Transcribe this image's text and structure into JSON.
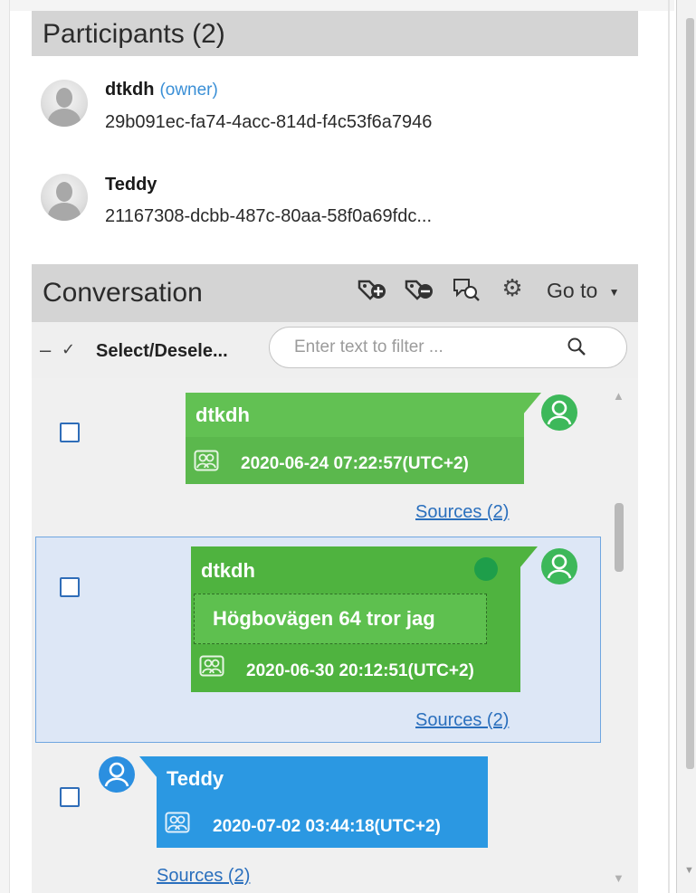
{
  "participants": {
    "header": "Participants (2)",
    "items": [
      {
        "name": "dtkdh",
        "role": "(owner)",
        "id": "29b091ec-fa74-4acc-814d-f4c53f6a7946",
        "icon": "person-placeholder-icon"
      },
      {
        "name": "Teddy",
        "role": "",
        "id": "21167308-dcbb-487c-80aa-58f0a69fdc...",
        "icon": "person-placeholder-icon"
      }
    ]
  },
  "conversation": {
    "header": "Conversation",
    "toolbar": {
      "icons": [
        "add-tag-icon",
        "remove-tag-icon",
        "search-chat-icon",
        "settings-gear-icon"
      ],
      "goto_label": "Go to"
    },
    "select_label": "Select/Desele...",
    "filter_placeholder": "Enter text to filter ...",
    "messages": [
      {
        "sender": "dtkdh",
        "timestamp": "2020-06-24 07:22:57(UTC+2)",
        "sources": "Sources (2)",
        "color": "#62c153"
      },
      {
        "sender": "dtkdh",
        "text": "Högbovägen 64 tror jag",
        "timestamp": "2020-06-30 20:12:51(UTC+2)",
        "sources": "Sources (2)",
        "color": "#4fb33f",
        "selected": true
      },
      {
        "sender": "Teddy",
        "timestamp": "2020-07-02 03:44:18(UTC+2)",
        "sources": "Sources (2)",
        "color": "#2b98e2"
      }
    ]
  },
  "colors": {
    "header_bg": "#d4d4d4",
    "selection_bg": "#dde7f6",
    "selection_border": "#6fa6e0",
    "link": "#2a6fbd",
    "owner": "#3a8fd6"
  }
}
